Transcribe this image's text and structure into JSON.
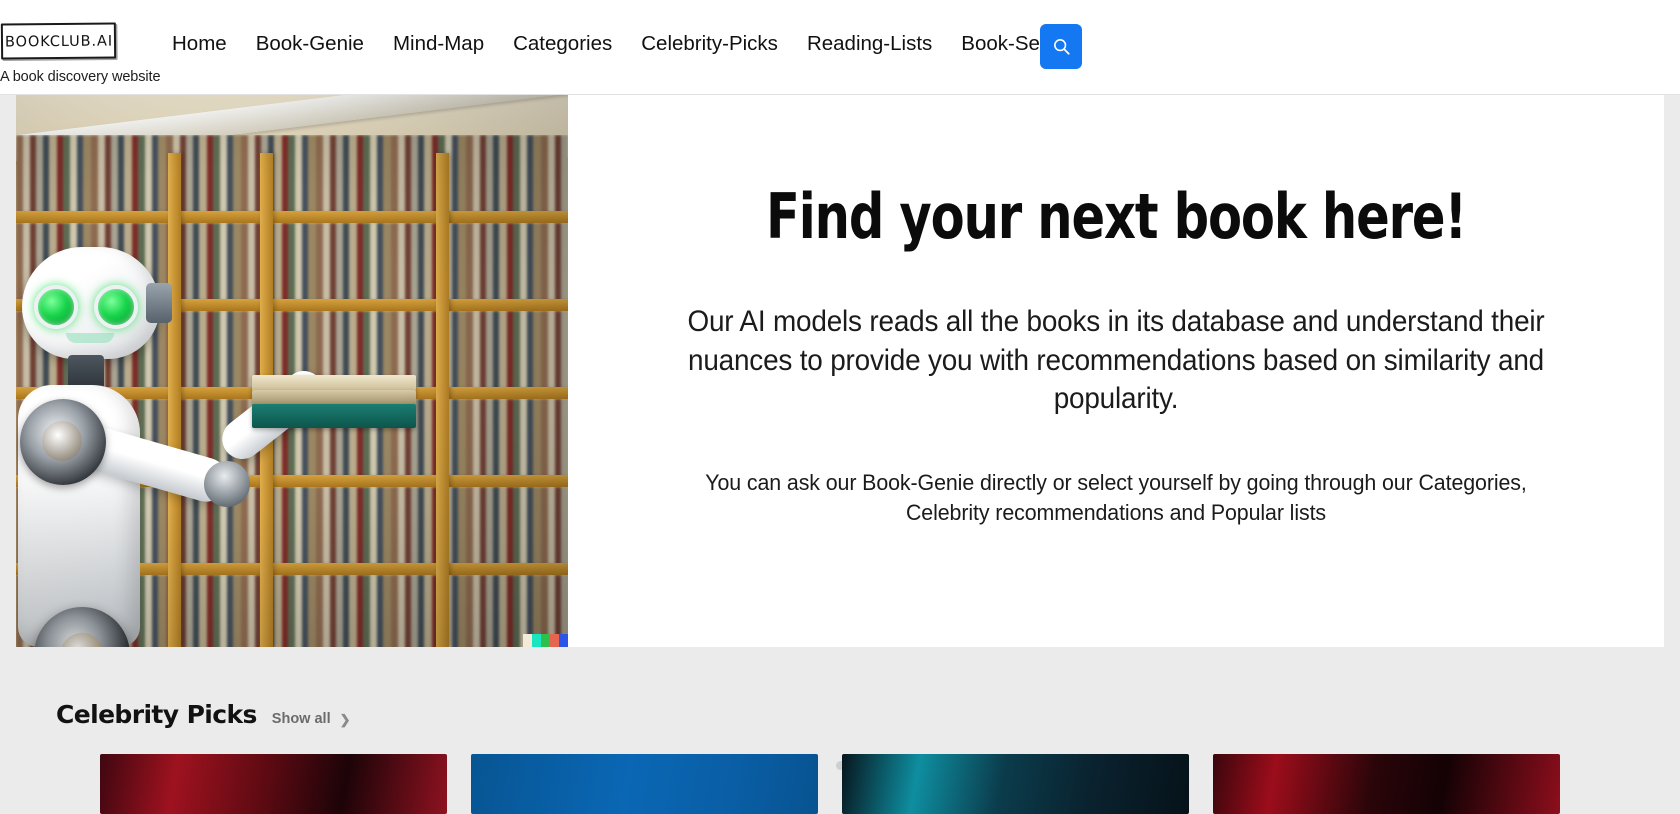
{
  "brand": {
    "logo_text": "BOOKCLUB.AI",
    "logo_icon": "bookclub-logo-box",
    "tagline": "A book discovery website"
  },
  "nav": {
    "items": [
      {
        "label": "Home",
        "name": "nav-home"
      },
      {
        "label": "Book-Genie",
        "name": "nav-book-genie"
      },
      {
        "label": "Mind-Map",
        "name": "nav-mind-map"
      },
      {
        "label": "Categories",
        "name": "nav-categories"
      },
      {
        "label": "Celebrity-Picks",
        "name": "nav-celebrity-picks"
      },
      {
        "label": "Reading-Lists",
        "name": "nav-reading-lists"
      },
      {
        "label": "Book-Series",
        "name": "nav-book-series"
      }
    ],
    "search": {
      "icon": "search-icon",
      "label": "Search",
      "color": "#1378f1"
    }
  },
  "hero": {
    "image_alt": "White robot with green eyes taking books from a library shelf",
    "title": "Find your next book here!",
    "subtitle": "Our AI models reads all the books in its database and understand their nuances to provide you with recommendations based on similarity and popularity.",
    "note": "You can ask our Book-Genie directly or select yourself by going through our Categories, Celebrity recommendations and Popular lists",
    "carousel": {
      "total_slides": 3,
      "active_slide": 1,
      "dot_active_color": "#2b2b2b",
      "dot_inactive_color": "#cfcfcf"
    }
  },
  "picks": {
    "title": "Celebrity Picks",
    "show_all_label": "Show all",
    "chevron_icon": "chevron-right-icon",
    "cards": [
      {
        "name": "pick-card-1",
        "color": "#7a0f18",
        "gradient": "linear-gradient(100deg,#3f0710 0%,#9e121f 22%,#5c0a12 48%,#1c0408 70%,#8e1220 100%)"
      },
      {
        "name": "pick-card-2",
        "color": "#0a5fa4",
        "gradient": "linear-gradient(100deg,#075593 0%,#0a67b4 45%,#0a5ea5 75%,#075391 100%)"
      },
      {
        "name": "pick-card-3",
        "color": "#0b2430",
        "gradient": "linear-gradient(100deg,#07161e 0%,#0e8ea0 22%,#0b3c4c 46%,#0a2330 70%,#061219 100%)"
      },
      {
        "name": "pick-card-4",
        "color": "#6e0a14",
        "gradient": "linear-gradient(100deg,#3a060c 0%,#9c0d1b 18%,#2a0509 46%,#140205 66%,#8d0e1c 100%)"
      }
    ]
  },
  "theme": {
    "page_background": "#ebebeb",
    "panel_background": "#ffffff",
    "accent": "#1378f1",
    "text": "#111111"
  }
}
